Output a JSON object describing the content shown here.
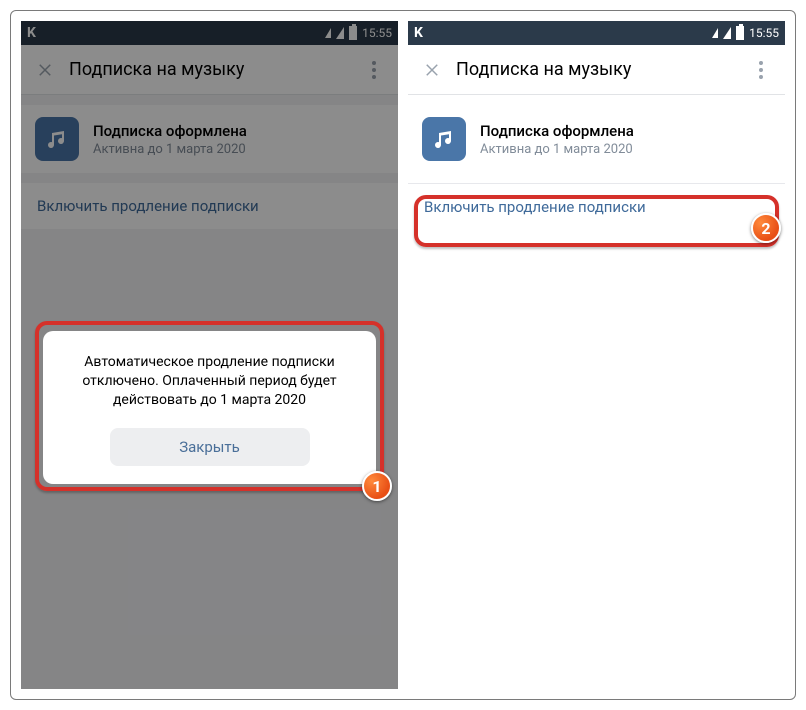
{
  "statusbar": {
    "carrier": "K",
    "time": "15:55"
  },
  "header": {
    "title": "Подписка на музыку"
  },
  "subscription": {
    "title": "Подписка оформлена",
    "status": "Активна до 1 марта 2020"
  },
  "renew_link": "Включить продление подписки",
  "dialog": {
    "message": "Автоматическое продление подписки отключено. Оплаченный период будет действовать до 1 марта 2020",
    "close_label": "Закрыть"
  },
  "callouts": {
    "badge1": "1",
    "badge2": "2"
  }
}
